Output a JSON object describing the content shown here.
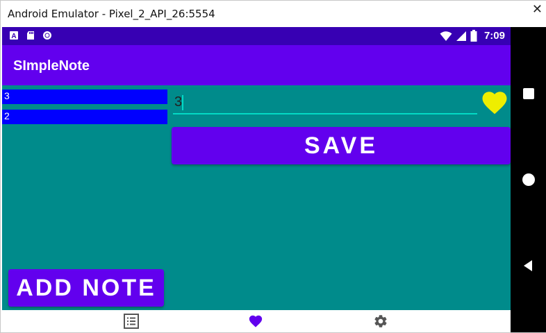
{
  "window": {
    "title": "Android Emulator - Pixel_2_API_26:5554",
    "close_glyph": "✕"
  },
  "statusbar": {
    "time": "7:09",
    "left_icons": [
      "a-notification-icon",
      "sd-card-icon",
      "circle-record-icon"
    ],
    "right_icons": [
      "wifi-icon",
      "signal-icon",
      "battery-icon"
    ]
  },
  "appbar": {
    "title": "SImpleNote"
  },
  "notes": [
    {
      "label": "3"
    },
    {
      "label": "2"
    }
  ],
  "editor": {
    "value": "3"
  },
  "favorite_icon": "heart-icon",
  "save_label": "SAVE",
  "add_note_label": "ADD NOTE",
  "bottom_nav": [
    {
      "name": "list-icon",
      "selected": false
    },
    {
      "name": "heart-icon",
      "selected": true
    },
    {
      "name": "settings-icon",
      "selected": false
    }
  ],
  "colors": {
    "primary": "#6200ee",
    "primary_dark": "#3700b3",
    "accent": "#03dac5",
    "background": "#008b8b",
    "note_item": "#0000ff",
    "heart": "#eeee00"
  }
}
